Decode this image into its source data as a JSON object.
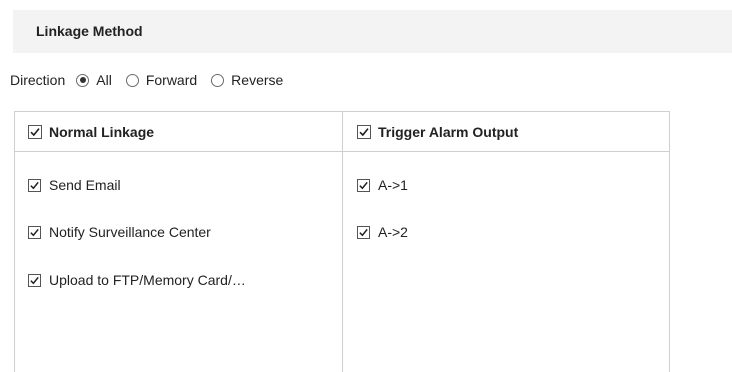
{
  "section": {
    "title": "Linkage Method"
  },
  "direction": {
    "label": "Direction",
    "options": [
      {
        "label": "All",
        "checked": true
      },
      {
        "label": "Forward",
        "checked": false
      },
      {
        "label": "Reverse",
        "checked": false
      }
    ]
  },
  "normal_linkage": {
    "header": "Normal Linkage",
    "header_checked": true,
    "items": [
      {
        "label": "Send Email",
        "checked": true
      },
      {
        "label": "Notify Surveillance Center",
        "checked": true
      },
      {
        "label": "Upload to FTP/Memory Card/…",
        "checked": true
      }
    ]
  },
  "trigger_alarm_output": {
    "header": "Trigger Alarm Output",
    "header_checked": true,
    "items": [
      {
        "label": "A->1",
        "checked": true
      },
      {
        "label": "A->2",
        "checked": true
      }
    ]
  }
}
